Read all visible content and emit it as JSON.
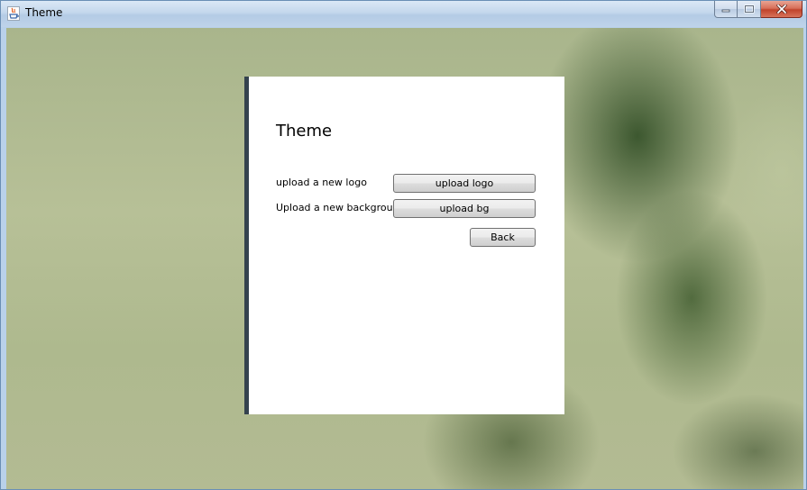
{
  "window": {
    "title": "Theme",
    "app_icon": "java-icon",
    "caption_buttons": {
      "minimize_icon": "minimize-icon",
      "maximize_icon": "maximize-icon",
      "close_icon": "close-icon"
    }
  },
  "panel": {
    "title": "Theme",
    "rows": [
      {
        "label": "upload a new logo",
        "button": "upload logo"
      },
      {
        "label": "Upload a new background",
        "button": "upload bg"
      }
    ],
    "back_label": "Back",
    "accent_color": "#34424e"
  }
}
